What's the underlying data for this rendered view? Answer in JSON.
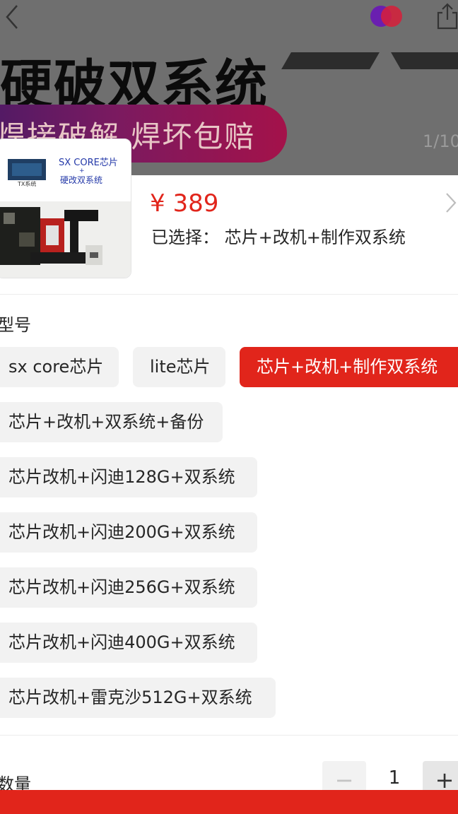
{
  "banner": {
    "title": "硬破双系统",
    "subtitle": "焊接破解 焊坏包赔",
    "pager": "1/10"
  },
  "thumbnail": {
    "chip_label": "SX CORE芯片",
    "plus": "+",
    "mod_label": "硬改双系统",
    "board_tag": "TX系统"
  },
  "product": {
    "price": "¥ 389",
    "selected_label": "已选择：",
    "selected_value": "芯片+改机+制作双系统"
  },
  "model_section": {
    "title": "型号",
    "options": [
      {
        "label": "sx core芯片",
        "active": false
      },
      {
        "label": "lite芯片",
        "active": false
      },
      {
        "label": "芯片+改机+制作双系统",
        "active": true
      },
      {
        "label": "芯片+改机+双系统+备份",
        "active": false
      },
      {
        "label": "芯片改机+闪迪128G+双系统",
        "active": false
      },
      {
        "label": "芯片改机+闪迪200G+双系统",
        "active": false
      },
      {
        "label": "芯片改机+闪迪256G+双系统",
        "active": false
      },
      {
        "label": "芯片改机+闪迪400G+双系统",
        "active": false
      },
      {
        "label": "芯片改机+雷克沙512G+双系统",
        "active": false
      }
    ]
  },
  "quantity": {
    "title": "数量",
    "minus": "−",
    "value": "1",
    "plus": "+"
  },
  "colors": {
    "accent": "#e1251b",
    "chip_bg": "#f2f2f2",
    "overlay": "#6f6f6f"
  }
}
